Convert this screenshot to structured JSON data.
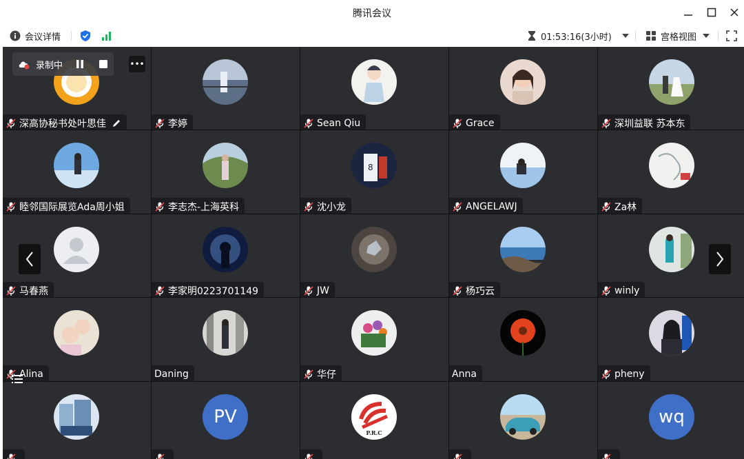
{
  "window": {
    "title": "腾讯会议"
  },
  "toolbar": {
    "meeting_details_label": "会议详情",
    "timer": "01:53:16(3小时)",
    "view_mode_label": "宫格视图"
  },
  "recording": {
    "label": "录制中"
  },
  "colors": {
    "shield": "#1e6fe8",
    "signal": "#1fb55a",
    "mic_muted": "#e04646",
    "tile_bg": "#2b2d31"
  },
  "participants": [
    {
      "name": "深高协秘书处叶思佳",
      "mic": "muted",
      "editable": true,
      "avatar": "orange-ring"
    },
    {
      "name": "李婷",
      "mic": "muted",
      "avatar": "photo-lake"
    },
    {
      "name": "Sean Qiu",
      "mic": "muted",
      "avatar": "photo-cartoon"
    },
    {
      "name": "Grace",
      "mic": "muted",
      "avatar": "photo-woman"
    },
    {
      "name": "深圳益联 苏本东",
      "mic": "muted",
      "avatar": "photo-wedding"
    },
    {
      "name": "睦邻国际展览Ada周小姐",
      "mic": "muted",
      "avatar": "photo-beach"
    },
    {
      "name": "李志杰-上海英科",
      "mic": "muted",
      "avatar": "photo-hill"
    },
    {
      "name": "沈小龙",
      "mic": "muted",
      "avatar": "photo-sports"
    },
    {
      "name": "ANGELAWJ",
      "mic": "muted",
      "avatar": "photo-sea"
    },
    {
      "name": "Za林",
      "mic": "muted",
      "avatar": "photo-sketch"
    },
    {
      "name": "马春燕",
      "mic": "muted",
      "avatar": "default-user"
    },
    {
      "name": "李家明0223701149",
      "mic": "muted",
      "avatar": "photo-tunnel"
    },
    {
      "name": "JW",
      "mic": "muted",
      "avatar": "photo-stone"
    },
    {
      "name": "杨巧云",
      "mic": "muted",
      "avatar": "photo-coast"
    },
    {
      "name": "winly",
      "mic": "muted",
      "avatar": "photo-garden"
    },
    {
      "name": "Alina",
      "mic": "muted",
      "avatar": "photo-baby"
    },
    {
      "name": "Daning",
      "mic": "none",
      "avatar": "photo-street"
    },
    {
      "name": "华仔",
      "mic": "muted",
      "avatar": "photo-flowers"
    },
    {
      "name": "Anna",
      "mic": "none",
      "avatar": "photo-redflower"
    },
    {
      "name": "pheny",
      "mic": "muted",
      "avatar": "photo-portrait"
    },
    {
      "name": "",
      "mic": "muted",
      "avatar": "photo-building"
    },
    {
      "name": "",
      "mic": "muted",
      "avatar": "text",
      "initials": "PV"
    },
    {
      "name": "",
      "mic": "muted",
      "avatar": "logo-prc",
      "logo_text": "P.R.C"
    },
    {
      "name": "",
      "mic": "muted",
      "avatar": "photo-car"
    },
    {
      "name": "",
      "mic": "muted",
      "avatar": "text",
      "initials": "wq"
    }
  ]
}
